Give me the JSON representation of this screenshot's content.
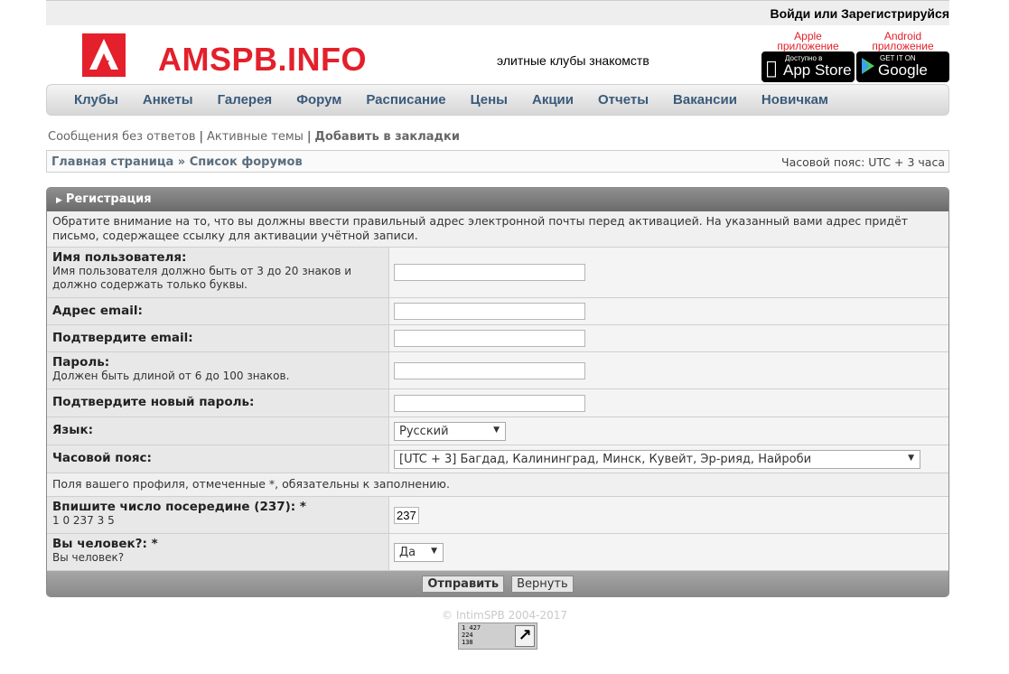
{
  "topbar": {
    "login": "Войди или Зарегистрируйся"
  },
  "header": {
    "logo_text": "AMSPB.INFO",
    "slogan": "элитные клубы знакомств",
    "apple": {
      "label1": "Apple",
      "label2": "приложение",
      "small": "Доступно в",
      "big": "App Store",
      "icon": "apple-icon"
    },
    "android": {
      "label1": "Android",
      "label2": "приложение",
      "small": "GET IT ON",
      "big": "Google play",
      "icon": "play-icon"
    }
  },
  "nav": [
    "Клубы",
    "Анкеты",
    "Галерея",
    "Форум",
    "Расписание",
    "Цены",
    "Акции",
    "Отчеты",
    "Вакансии",
    "Новичкам"
  ],
  "links": {
    "unanswered": "Сообщения без ответов",
    "active": "Активные темы",
    "bookmark": "Добавить в закладки"
  },
  "breadcrumb": {
    "path": "Главная страница » Список форумов",
    "timezone": "Часовой пояс: UTC + 3 часа"
  },
  "form": {
    "title": "Регистрация",
    "notice": "Обратите внимание на то, что вы должны ввести правильный адрес электронной почты перед активацией. На указанный вами адрес придёт письмо, содержащее ссылку для активации учётной записи.",
    "username_label": "Имя пользователя:",
    "username_hint": "Имя пользователя должно быть от 3 до 20 знаков и должно содержать только буквы.",
    "email_label": "Адрес email:",
    "email_confirm_label": "Подтвердите email:",
    "password_label": "Пароль:",
    "password_hint": "Должен быть длиной от 6 до 100 знаков.",
    "password_confirm_label": "Подтвердите новый пароль:",
    "language_label": "Язык:",
    "language_value": "Русский",
    "timezone_label": "Часовой пояс:",
    "timezone_value": "[UTC + 3] Багдад, Калининград, Минск, Кувейт, Эр-рияд, Найроби",
    "profile_notice": "Поля вашего профиля, отмеченные *, обязательны к заполнению.",
    "captcha_label": "Впишите число посередине (237): *",
    "captcha_hint": "1 0 237 3 5",
    "captcha_value": "237",
    "human_label": "Вы человек?: *",
    "human_hint": "Вы человек?",
    "human_value": "Да",
    "submit": "Отправить",
    "reset": "Вернуть"
  },
  "footer": {
    "copyright": "© IntimSPB 2004-2017"
  },
  "counter": {
    "line1": "1 427",
    "line2": "224",
    "line3": "138"
  },
  "colors": {
    "brand": "#e3202b",
    "nav_text": "#3a5a7a"
  }
}
